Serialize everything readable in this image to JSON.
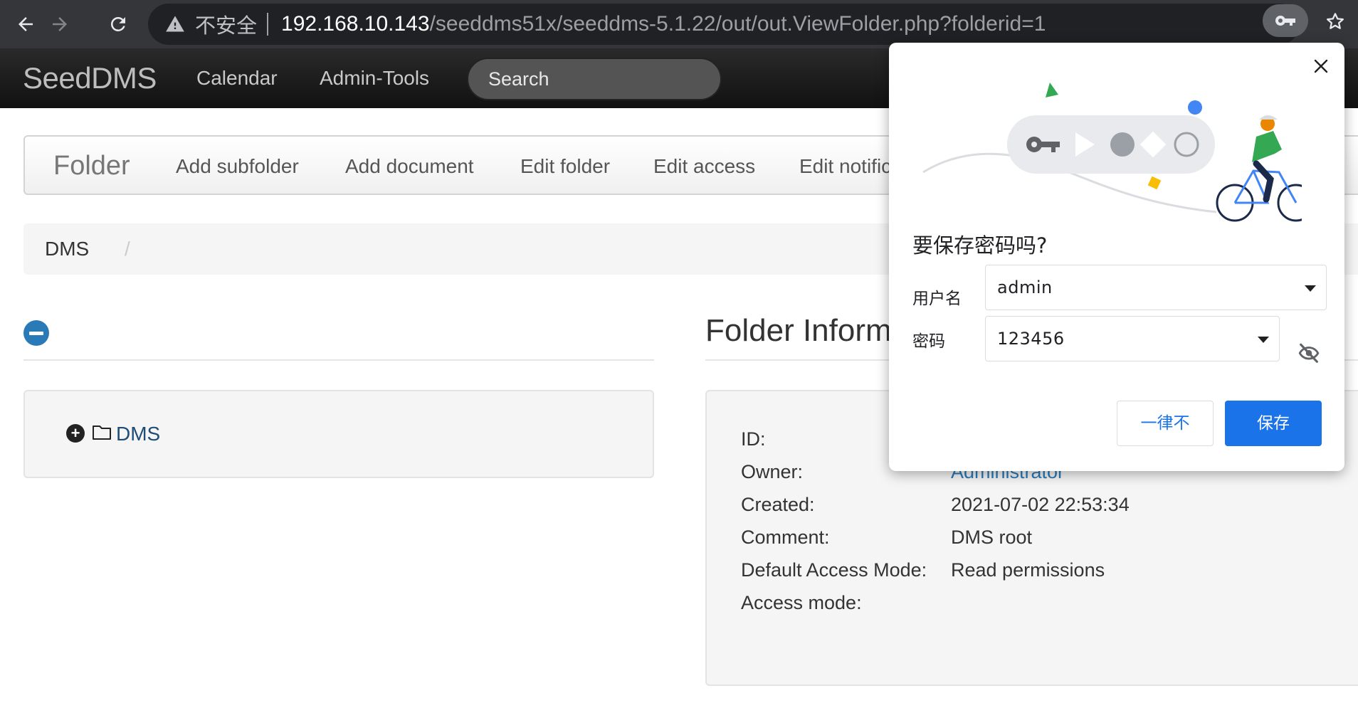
{
  "browser": {
    "security_label": "不安全",
    "url_host": "192.168.10.143",
    "url_path": "/seeddms51x/seeddms-5.1.22/out/out.ViewFolder.php?folderid=1",
    "icons": [
      "back-icon",
      "forward-icon",
      "reload-icon",
      "warning-icon",
      "key-icon",
      "star-icon"
    ]
  },
  "navbar": {
    "brand": "SeedDMS",
    "links": [
      "Calendar",
      "Admin-Tools"
    ],
    "search_placeholder": "Search"
  },
  "subnav": {
    "title": "Folder",
    "links": [
      "Add subfolder",
      "Add document",
      "Edit folder",
      "Edit access",
      "Edit notific"
    ]
  },
  "breadcrumb": {
    "items": [
      "DMS"
    ],
    "separator": "/"
  },
  "tree": {
    "root_label": "DMS"
  },
  "folder_info": {
    "title": "Folder Informa",
    "rows": [
      {
        "label": "ID:",
        "value": ""
      },
      {
        "label": "Owner:",
        "value": "Administrator"
      },
      {
        "label": "Created:",
        "value": "2021-07-02 22:53:34"
      },
      {
        "label": "Comment:",
        "value": "DMS root"
      },
      {
        "label": "Default Access Mode:",
        "value": "Read permissions"
      },
      {
        "label": "Access mode:",
        "value": ""
      }
    ]
  },
  "password_dialog": {
    "title": "要保存密码吗?",
    "username_label": "用户名",
    "username_value": "admin",
    "password_label": "密码",
    "password_value": "123456",
    "never_button": "一律不",
    "save_button": "保存"
  },
  "colors": {
    "chrome_bg": "#35363a",
    "omnibox_bg": "#202124",
    "navbar_bg": "#1b1b1b",
    "link_blue": "#2a7ab8",
    "dialog_primary": "#1a73e8"
  }
}
